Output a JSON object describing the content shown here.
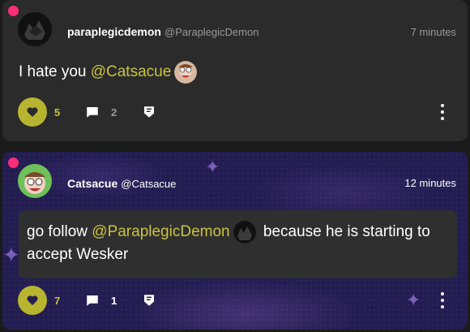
{
  "posts": [
    {
      "username": "paraplegicdemon",
      "handle": "@ParaplegicDemon",
      "time": "7 minutes",
      "text_before": "I hate you ",
      "mention": "@Catsacue",
      "text_after": "",
      "likes": "5",
      "comments": "2"
    },
    {
      "username": "Catsacue",
      "handle": "@Catsacue",
      "time": "12 minutes",
      "text_before": "go follow ",
      "mention": "@ParaplegicDemon",
      "text_after": " because he is starting to accept Wesker",
      "likes": "7",
      "comments": "1"
    }
  ],
  "colors": {
    "accent": "#c9c53a",
    "like_button": "#b7b530",
    "notification_dot": "#ff2d7a",
    "card_dark": "#2b2b2b",
    "card_space": "#241d52"
  },
  "icons": [
    "heart-icon",
    "comment-icon",
    "share-icon",
    "more-icon"
  ]
}
